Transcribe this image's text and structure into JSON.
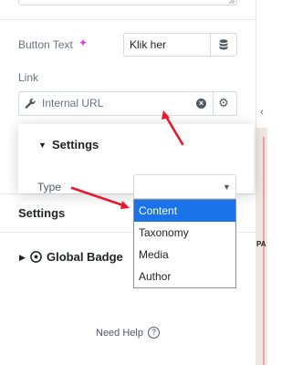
{
  "button_text": {
    "label": "Button Text",
    "value": "Klik her",
    "ai_icon": "sparkle-icon",
    "dynamic_icon": "database-icon"
  },
  "link": {
    "label": "Link",
    "value": "Internal URL",
    "prefix_icon": "wrench-icon",
    "clear_icon": "clear-icon",
    "settings_icon": "gear-icon"
  },
  "popup": {
    "title": "Settings",
    "type_label": "Type",
    "type_value": "",
    "options": [
      "Content",
      "Taxonomy",
      "Media",
      "Author"
    ],
    "selected_option": "Content"
  },
  "sections": {
    "settings": "Settings",
    "global_badge": "Global Badge"
  },
  "help": {
    "text": "Need Help",
    "icon": "question-circle-icon"
  },
  "right_strip": {
    "text": "PA"
  },
  "colors": {
    "accent_pink": "#d63ff0",
    "selected_option_bg": "#1a73e8",
    "annotation_red": "#e8192c"
  }
}
